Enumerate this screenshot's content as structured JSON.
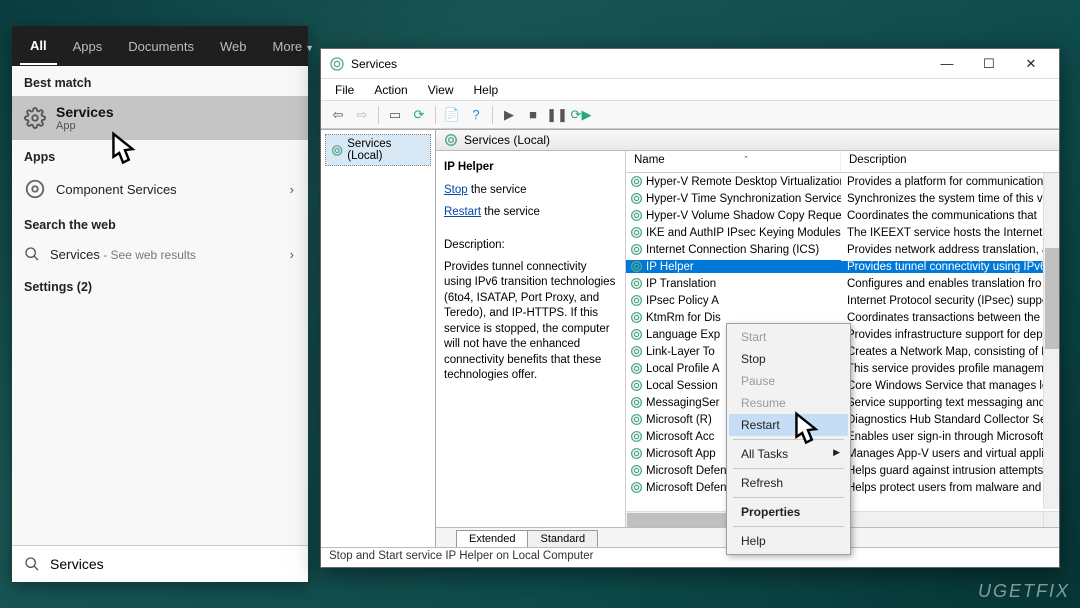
{
  "search": {
    "tabs": [
      "All",
      "Apps",
      "Documents",
      "Web",
      "More"
    ],
    "best_match_label": "Best match",
    "best_match": {
      "title": "Services",
      "sub": "App"
    },
    "apps_label": "Apps",
    "apps_item": "Component Services",
    "web_label": "Search the web",
    "web_item_prefix": "Services",
    "web_item_suffix": " - See web results",
    "settings_label": "Settings (2)",
    "query": "Services"
  },
  "window": {
    "title": "Services",
    "menu": [
      "File",
      "Action",
      "View",
      "Help"
    ],
    "tree_root": "Services (Local)",
    "content_header": "Services (Local)",
    "selected_name": "IP Helper",
    "stop_link": "Stop",
    "stop_suffix": " the service",
    "restart_link": "Restart",
    "restart_suffix": " the service",
    "desc_label": "Description:",
    "desc_text": "Provides tunnel connectivity using IPv6 transition technologies (6to4, ISATAP, Port Proxy, and Teredo), and IP-HTTPS. If this service is stopped, the computer will not have the enhanced connectivity benefits that these technologies offer.",
    "col_name": "Name",
    "col_desc": "Description",
    "tabs": [
      "Extended",
      "Standard"
    ],
    "status": "Stop and Start service IP Helper on Local Computer"
  },
  "services": [
    {
      "name": "Hyper-V Remote Desktop Virtualization...",
      "desc": "Provides a platform for communication"
    },
    {
      "name": "Hyper-V Time Synchronization Service",
      "desc": "Synchronizes the system time of this vi"
    },
    {
      "name": "Hyper-V Volume Shadow Copy Reques...",
      "desc": "Coordinates the communications that"
    },
    {
      "name": "IKE and AuthIP IPsec Keying Modules",
      "desc": "The IKEEXT service hosts the Internet Ke"
    },
    {
      "name": "Internet Connection Sharing (ICS)",
      "desc": "Provides network address translation, a"
    },
    {
      "name": "IP Helper",
      "desc": "Provides tunnel connectivity using IPv6",
      "selected": true
    },
    {
      "name": "IP Translation ",
      "desc": "Configures and enables translation fro"
    },
    {
      "name": "IPsec Policy A",
      "desc": "Internet Protocol security (IPsec) suppo"
    },
    {
      "name": "KtmRm for Dis",
      "desc": "Coordinates transactions between the I"
    },
    {
      "name": "Language Exp",
      "desc": "Provides infrastructure support for dep"
    },
    {
      "name": "Link-Layer To",
      "desc": "Creates a Network Map, consisting of P"
    },
    {
      "name": "Local Profile A",
      "desc": "This service provides profile manageme"
    },
    {
      "name": "Local Session",
      "desc": "Core Windows Service that manages lo"
    },
    {
      "name": "MessagingSer",
      "desc": "Service supporting text messaging and"
    },
    {
      "name": "Microsoft (R) ",
      "desc": "Diagnostics Hub Standard Collector Se"
    },
    {
      "name": "Microsoft Acc",
      "desc": "Enables user sign-in through Microsoft"
    },
    {
      "name": "Microsoft App",
      "desc": "Manages App-V users and virtual appli"
    },
    {
      "name": "Microsoft Defender Antivirus Network I...",
      "desc": "Helps guard against intrusion attempts"
    },
    {
      "name": "Microsoft Defender Antivirus Service",
      "desc": "Helps protect users from malware and"
    }
  ],
  "context_menu": {
    "items": [
      {
        "label": "Start",
        "state": "disabled"
      },
      {
        "label": "Stop",
        "state": ""
      },
      {
        "label": "Pause",
        "state": "disabled"
      },
      {
        "label": "Resume",
        "state": "disabled"
      },
      {
        "label": "Restart",
        "state": "hover"
      }
    ],
    "all_tasks": "All Tasks",
    "refresh": "Refresh",
    "properties": "Properties",
    "help": "Help"
  },
  "watermark": "UGETFIX"
}
